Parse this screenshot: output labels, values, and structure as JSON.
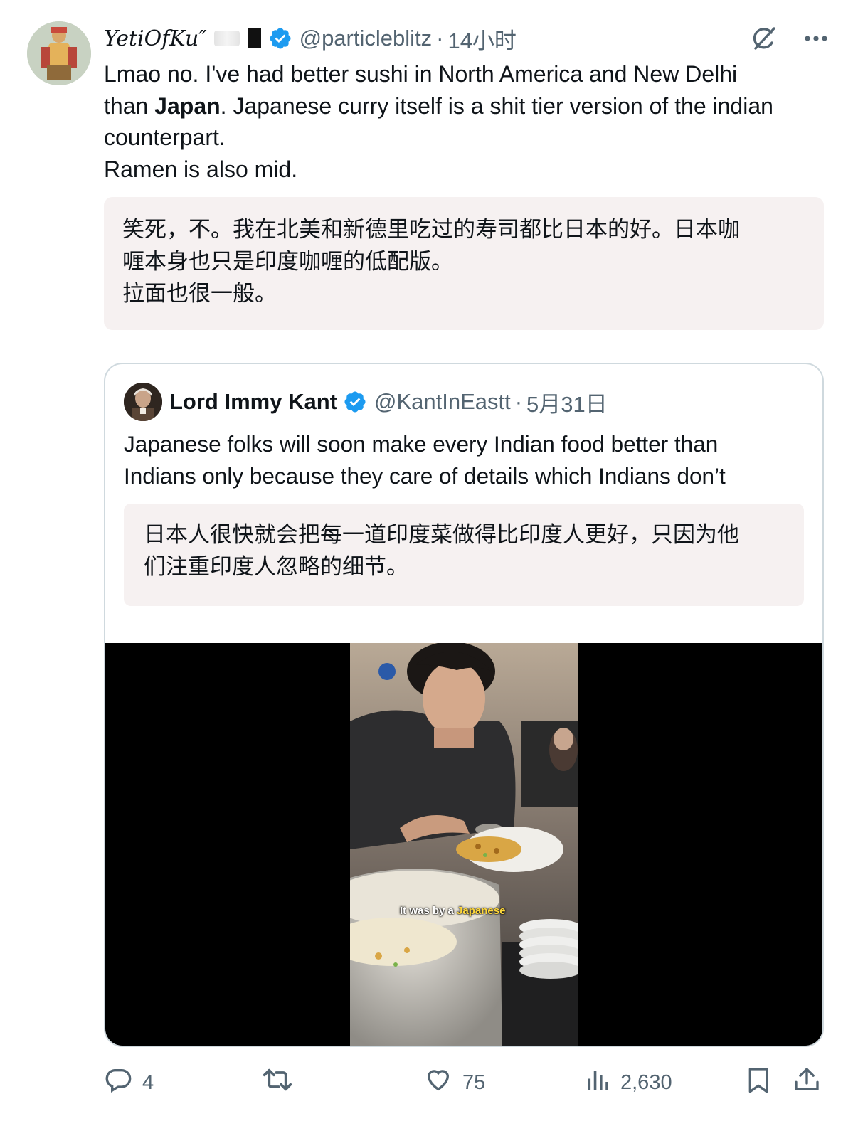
{
  "tweet": {
    "display_name": "YetiOfKu″",
    "handle": "@particleblitz",
    "separator": "·",
    "time": "14小时",
    "text_line1": "Lmao no. I've had better sushi in North America and New Delhi",
    "text_line2_pre": "than ",
    "text_line2_bold": "Japan",
    "text_line2_post": ". Japanese curry itself is a shit tier version of the indian",
    "text_line3": "counterpart.",
    "text_line4": "Ramen is also mid.",
    "translation_line1": "笑死，不。我在北美和新德里吃过的寿司都比日本的好。日本咖",
    "translation_line2": "喱本身也只是印度咖喱的低配版。",
    "translation_line3": "拉面也很一般。"
  },
  "quote": {
    "display_name": "Lord Immy Kant",
    "handle": "@KantInEastt",
    "separator": "·",
    "date": "5月31日",
    "text_line1": "Japanese folks will soon make every Indian food better than",
    "text_line2": "Indians only because they care of details which Indians don’t",
    "translation_line1": "日本人很快就会把每一道印度菜做得比印度人更好，只因为他",
    "translation_line2": "们注重印度人忽略的细节。",
    "video_caption_pre": "It was by a ",
    "video_caption_highlight": "Japanese"
  },
  "actions": {
    "replies": "4",
    "likes": "75",
    "views": "2,630"
  },
  "colors": {
    "verified_blue": "#1d9bf0",
    "muted_text": "#536471",
    "translation_bg": "#f6f1f1"
  },
  "icons": {
    "verified": "verified-badge-icon",
    "grok": "grok-slash-icon",
    "more": "more-dots-icon",
    "reply": "reply-bubble-icon",
    "retweet": "retweet-icon",
    "like": "heart-icon",
    "views": "views-bar-chart-icon",
    "bookmark": "bookmark-icon",
    "share": "share-upload-icon"
  }
}
